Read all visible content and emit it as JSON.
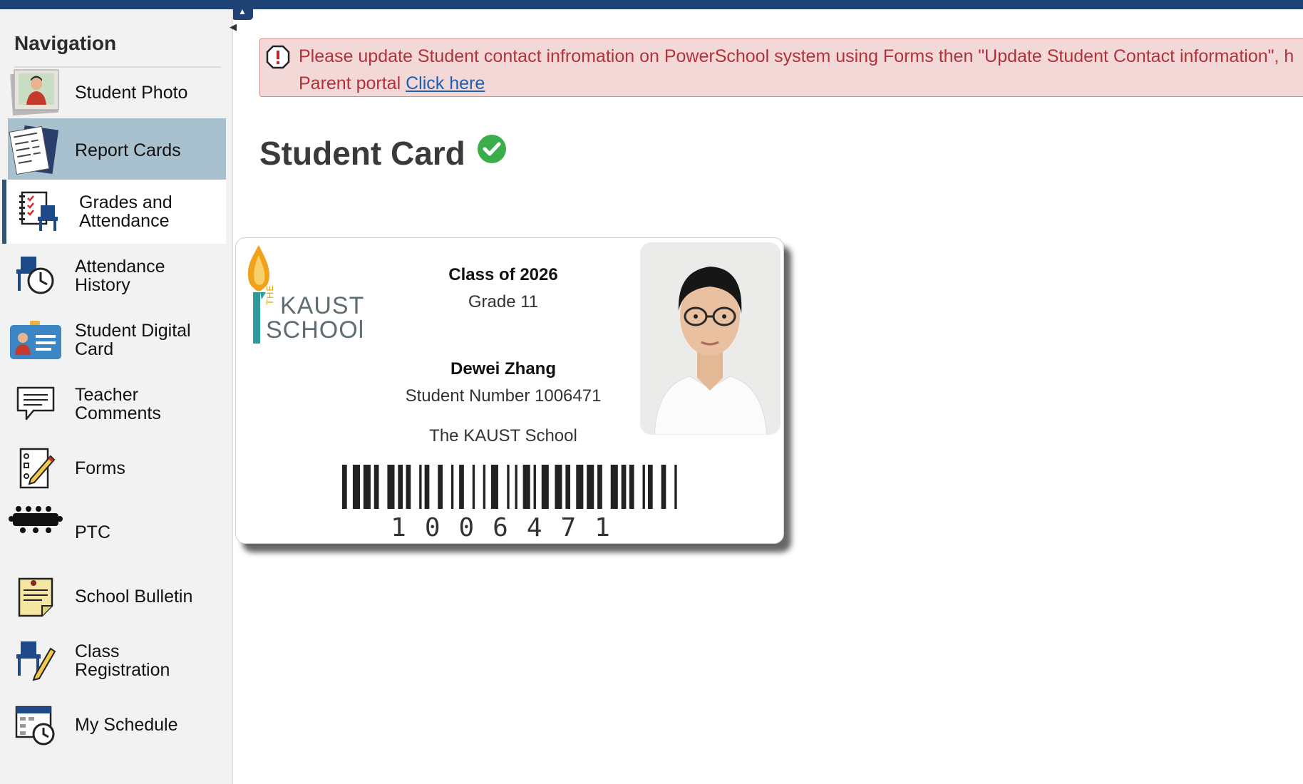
{
  "navigation": {
    "title": "Navigation",
    "items": [
      {
        "label": "Student Photo",
        "icon": "student-photo-icon"
      },
      {
        "label": "Report Cards",
        "icon": "report-cards-icon"
      },
      {
        "label": "Grades and Attendance",
        "icon": "grades-attendance-icon"
      },
      {
        "label": "Attendance History",
        "icon": "attendance-history-icon"
      },
      {
        "label": "Student Digital Card",
        "icon": "digital-card-icon"
      },
      {
        "label": "Teacher Comments",
        "icon": "speech-bubble-icon"
      },
      {
        "label": "Forms",
        "icon": "forms-icon"
      },
      {
        "label": "PTC",
        "icon": "ptc-meeting-icon"
      },
      {
        "label": "School Bulletin",
        "icon": "bulletin-icon"
      },
      {
        "label": "Class Registration",
        "icon": "class-registration-icon"
      },
      {
        "label": "My Schedule",
        "icon": "schedule-icon"
      }
    ]
  },
  "alert": {
    "text_line1": "Please update Student contact infromation on PowerSchool system using Forms then \"Update Student Contact information\", h",
    "text_line2": "Parent portal ",
    "link": "Click here"
  },
  "page": {
    "title": "Student Card"
  },
  "card": {
    "logo_the": "THE",
    "logo_kaust": "KAUST",
    "logo_school": "SCHOOl",
    "class_of": "Class of 2026",
    "grade": "Grade 11",
    "name": "Dewei Zhang",
    "student_number": "Student Number 1006471",
    "school": "The KAUST School",
    "barcode_number": "1006471"
  },
  "colors": {
    "topbar": "#1e4273",
    "active_item": "#a9c0cf",
    "alert_bg": "#f3d8d8",
    "alert_text": "#b3313a",
    "check_green": "#3aae4a"
  }
}
